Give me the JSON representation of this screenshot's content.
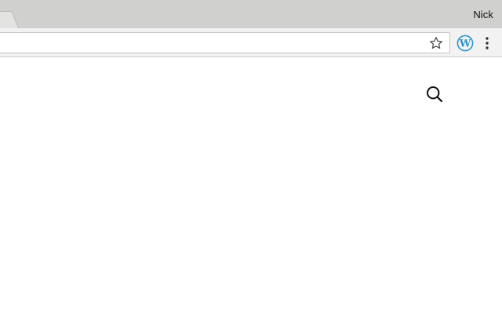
{
  "browser": {
    "profile_name": "Nick",
    "address_bar": {
      "value": ""
    }
  },
  "icons": {
    "bookmark": "star-icon",
    "extension": "wordpress-icon",
    "menu": "more-vertical-icon",
    "page_search": "search-icon"
  },
  "colors": {
    "tabstrip": "#d0d0ce",
    "toolbar": "#f2f2f2",
    "wordpress": "#2f98c9",
    "page_background": "#ffffff"
  }
}
